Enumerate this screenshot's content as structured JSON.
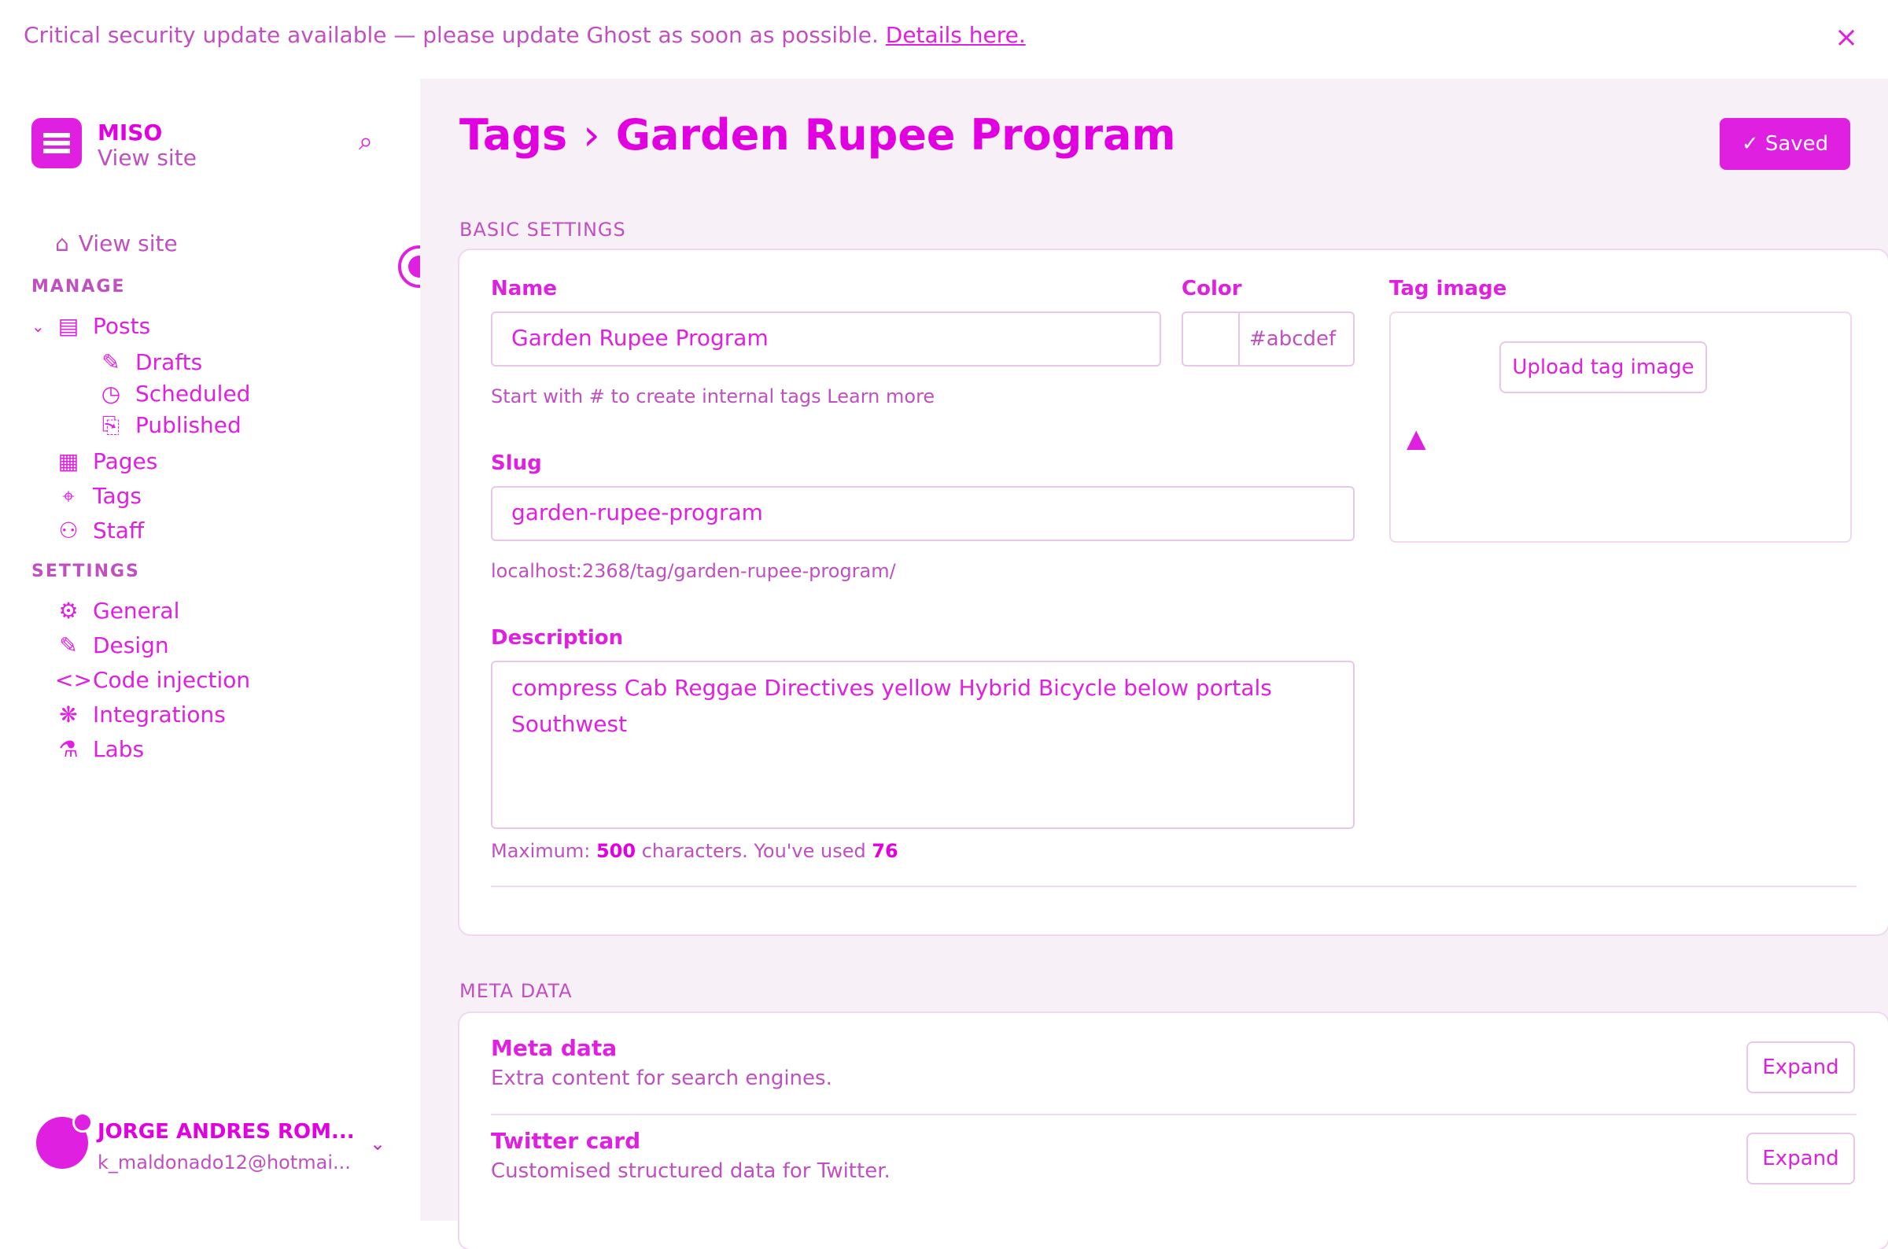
{
  "banner": {
    "message": "Critical security update available — please update Ghost as soon as possible.",
    "link": "Details here.",
    "close_icon": "×"
  },
  "brand": {
    "name": "MISO",
    "view_site": "View site",
    "search_icon": "⌕"
  },
  "sidebar": {
    "view_site": "View site",
    "manage_label": "MANAGE",
    "settings_label": "SETTINGS",
    "manage_items": [
      {
        "label": "Posts",
        "icon": "▤"
      },
      {
        "label": "Drafts",
        "icon": "✎"
      },
      {
        "label": "Scheduled",
        "icon": "◷"
      },
      {
        "label": "Published",
        "icon": "⎘"
      },
      {
        "label": "Pages",
        "icon": "▦"
      },
      {
        "label": "Tags",
        "icon": "⌖"
      },
      {
        "label": "Staff",
        "icon": "⚇"
      }
    ],
    "settings_items": [
      {
        "label": "General",
        "icon": "⚙"
      },
      {
        "label": "Design",
        "icon": "✎"
      },
      {
        "label": "Code injection",
        "icon": "<>"
      },
      {
        "label": "Integrations",
        "icon": "❋"
      },
      {
        "label": "Labs",
        "icon": "⚗"
      }
    ]
  },
  "user": {
    "name": "JORGE ANDRES ROM...",
    "email": "k_maldonado12@hotmai...",
    "chevron": "⌄"
  },
  "header": {
    "breadcrumb_root": "Tags",
    "breadcrumb_sep": "›",
    "title": "Garden Rupee Program",
    "saved_label": "✓ Saved"
  },
  "basic": {
    "section_title": "BASIC SETTINGS",
    "name_label": "Name",
    "name_value": "Garden Rupee Program",
    "name_hint": "Start with # to create internal tags",
    "learn_more": "Learn more",
    "color_label": "Color",
    "color_value": "#abcdef",
    "slug_label": "Slug",
    "slug_value": "garden-rupee-program",
    "slug_url": "localhost:2368/tag/garden-rupee-program/",
    "description_label": "Description",
    "description_value": "compress Cab Reggae Directives yellow Hybrid Bicycle below portals Southwest",
    "desc_hint_prefix": "Maximum:",
    "desc_max": "500",
    "desc_hint_mid": "characters. You've used",
    "desc_used": "76",
    "image_label": "Tag image",
    "upload_label": "Upload tag image",
    "image_icon": "▲"
  },
  "meta": {
    "section_title": "META DATA",
    "rows": [
      {
        "title": "Meta data",
        "sub": "Extra content for search engines.",
        "action": "Expand"
      },
      {
        "title": "Twitter card",
        "sub": "Customised structured data for Twitter.",
        "action": "Expand"
      }
    ]
  }
}
